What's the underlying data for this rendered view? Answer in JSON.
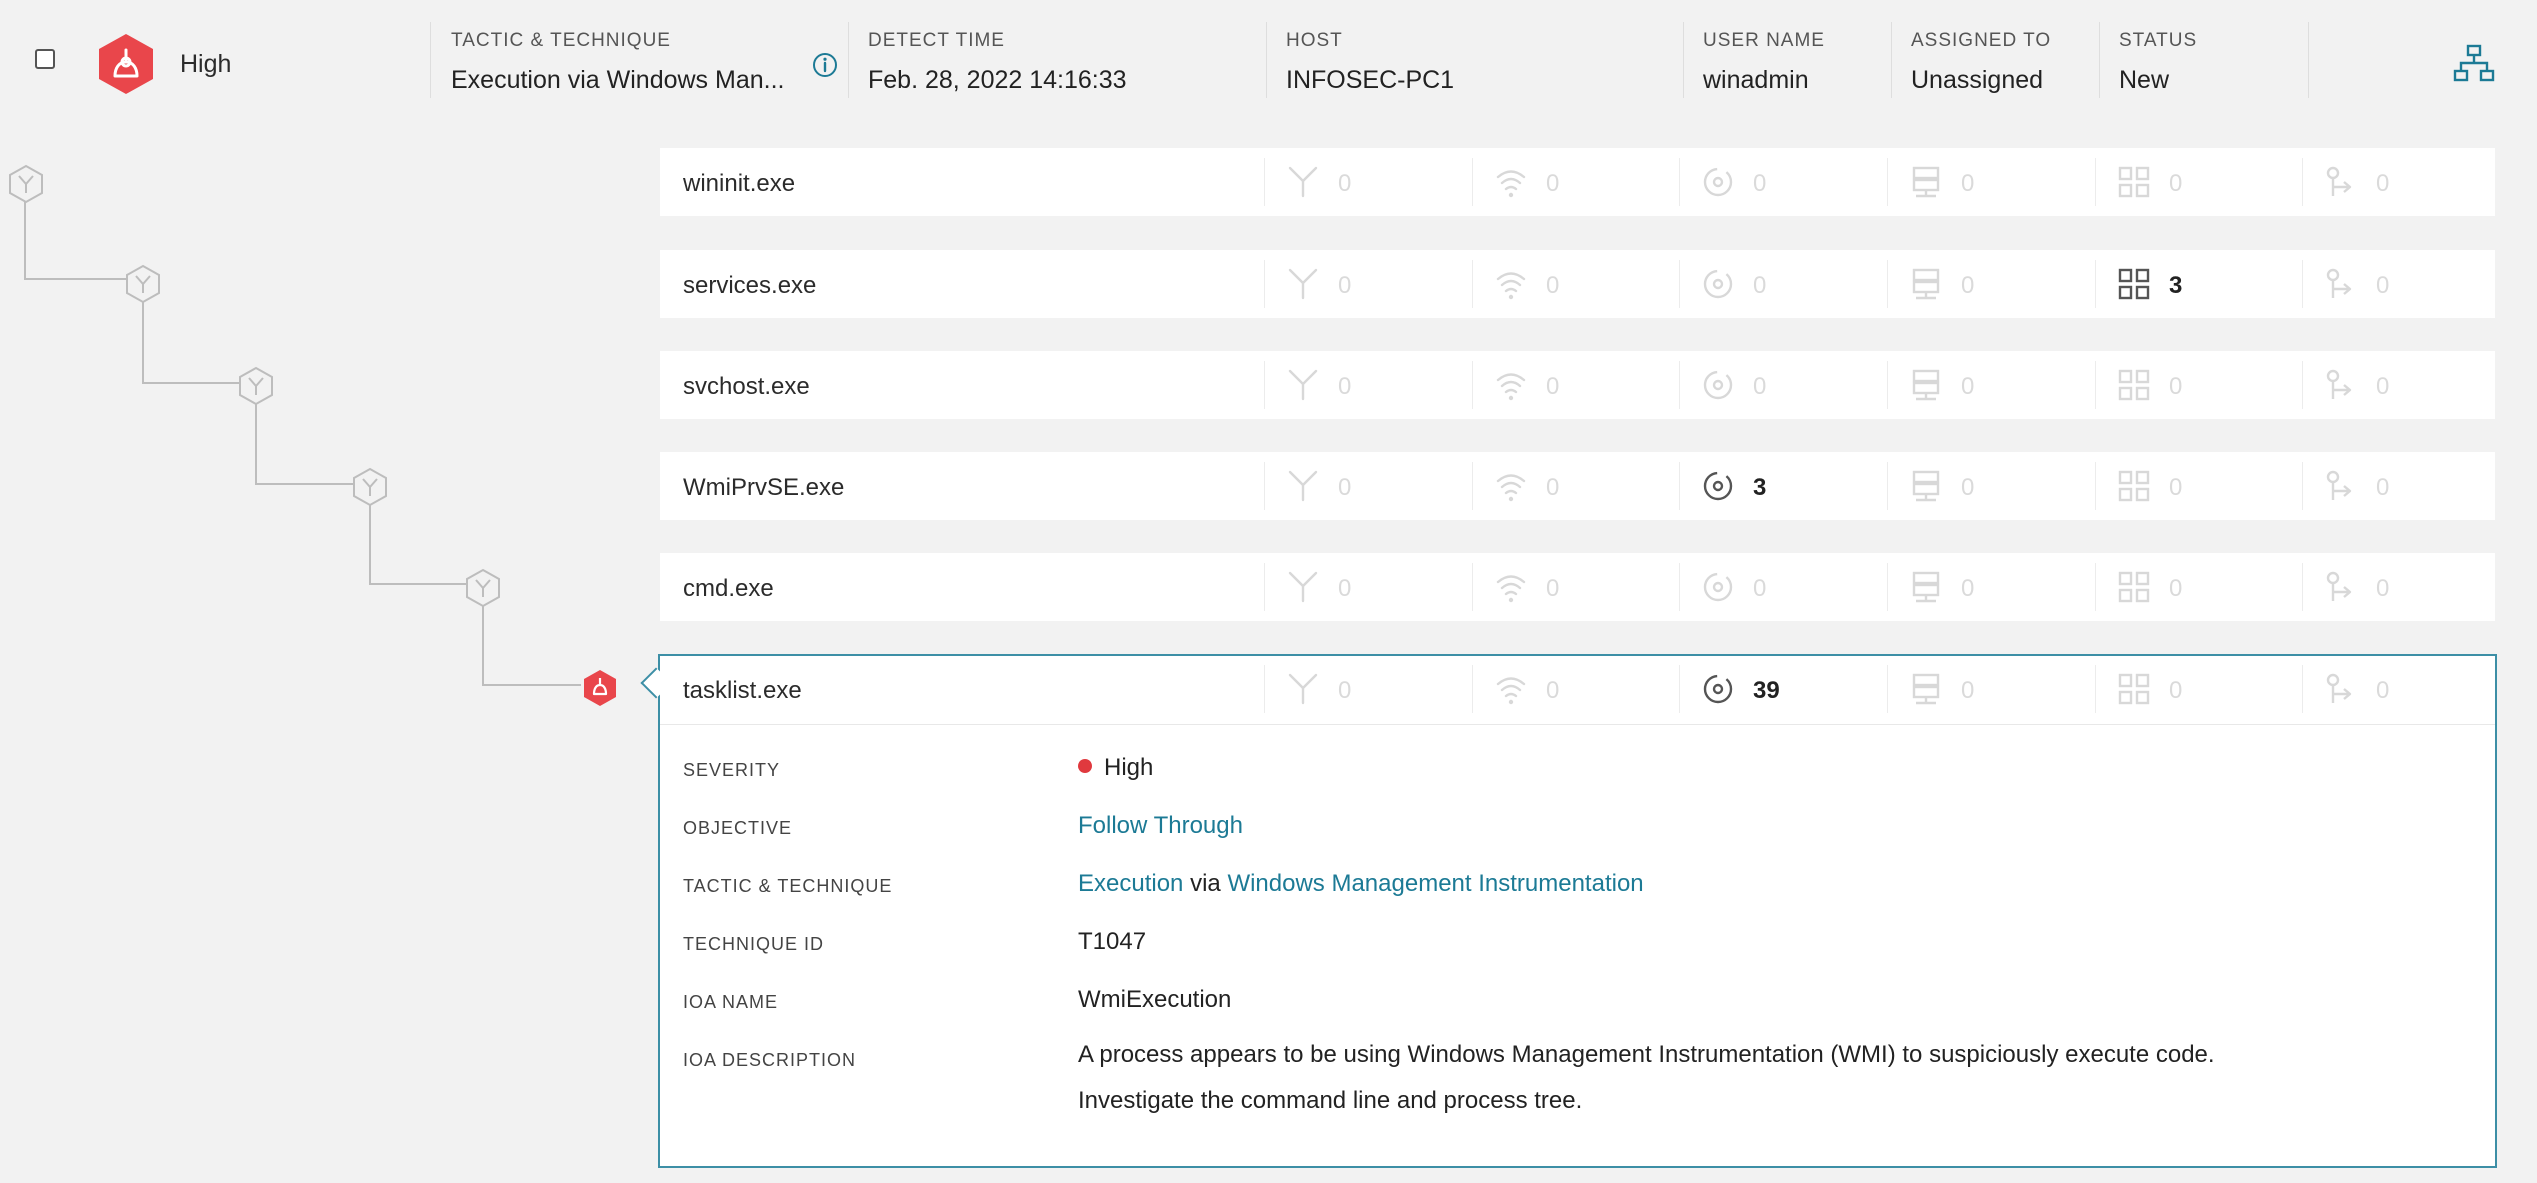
{
  "header": {
    "severity": "High",
    "tactic_label": "TACTIC & TECHNIQUE",
    "tactic_value": "Execution via Windows Man...",
    "detect_label": "DETECT TIME",
    "detect_value": "Feb. 28, 2022 14:16:33",
    "host_label": "HOST",
    "host_value": "INFOSEC-PC1",
    "user_label": "USER NAME",
    "user_value": "winadmin",
    "assigned_label": "ASSIGNED TO",
    "assigned_value": "Unassigned",
    "status_label": "STATUS",
    "status_value": "New"
  },
  "columns": [
    {
      "icon": "process-branch-icon"
    },
    {
      "icon": "network-icon"
    },
    {
      "icon": "disk-operation-icon"
    },
    {
      "icon": "dns-server-icon"
    },
    {
      "icon": "module-grid-icon"
    },
    {
      "icon": "registry-key-icon"
    }
  ],
  "processes": [
    {
      "name": "wininit.exe",
      "counts": [
        "0",
        "0",
        "0",
        "0",
        "0",
        "0"
      ]
    },
    {
      "name": "services.exe",
      "counts": [
        "0",
        "0",
        "0",
        "0",
        "3",
        "0"
      ]
    },
    {
      "name": "svchost.exe",
      "counts": [
        "0",
        "0",
        "0",
        "0",
        "0",
        "0"
      ]
    },
    {
      "name": "WmiPrvSE.exe",
      "counts": [
        "0",
        "0",
        "3",
        "0",
        "0",
        "0"
      ]
    },
    {
      "name": "cmd.exe",
      "counts": [
        "0",
        "0",
        "0",
        "0",
        "0",
        "0"
      ]
    },
    {
      "name": "tasklist.exe",
      "counts": [
        "0",
        "0",
        "39",
        "0",
        "0",
        "0"
      ]
    }
  ],
  "details": {
    "severity_label": "SEVERITY",
    "severity_value": "High",
    "objective_label": "OBJECTIVE",
    "objective_value": "Follow Through",
    "tactic_label": "TACTIC & TECHNIQUE",
    "tactic_link": "Execution",
    "tactic_via": "via",
    "technique_link": "Windows Management Instrumentation",
    "technique_id_label": "TECHNIQUE ID",
    "technique_id_value": "T1047",
    "ioa_name_label": "IOA NAME",
    "ioa_name_value": "WmiExecution",
    "ioa_desc_label": "IOA DESCRIPTION",
    "ioa_desc_line1": "A process appears to be using Windows Management Instrumentation (WMI) to suspiciously execute code.",
    "ioa_desc_line2": "Investigate the command line and process tree."
  },
  "colors": {
    "accent": "#1c7a95",
    "severity_red": "#e9464b",
    "border_active": "#3d8fa6"
  }
}
